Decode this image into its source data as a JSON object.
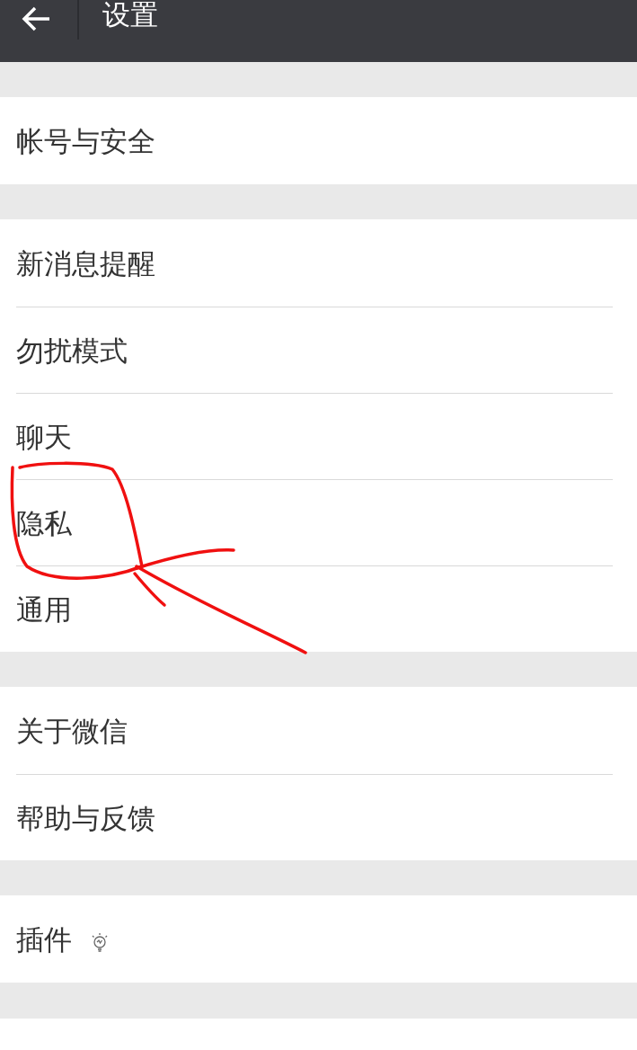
{
  "header": {
    "title": "设置"
  },
  "sections": [
    {
      "items": [
        {
          "label": "帐号与安全",
          "kind": "plain"
        }
      ]
    },
    {
      "items": [
        {
          "label": "新消息提醒",
          "kind": "plain"
        },
        {
          "label": "勿扰模式",
          "kind": "plain"
        },
        {
          "label": "聊天",
          "kind": "plain"
        },
        {
          "label": "隐私",
          "kind": "plain"
        },
        {
          "label": "通用",
          "kind": "plain"
        }
      ]
    },
    {
      "items": [
        {
          "label": "关于微信",
          "kind": "plain"
        },
        {
          "label": "帮助与反馈",
          "kind": "plain"
        }
      ]
    },
    {
      "items": [
        {
          "label": "插件",
          "kind": "with_icon"
        }
      ]
    }
  ]
}
